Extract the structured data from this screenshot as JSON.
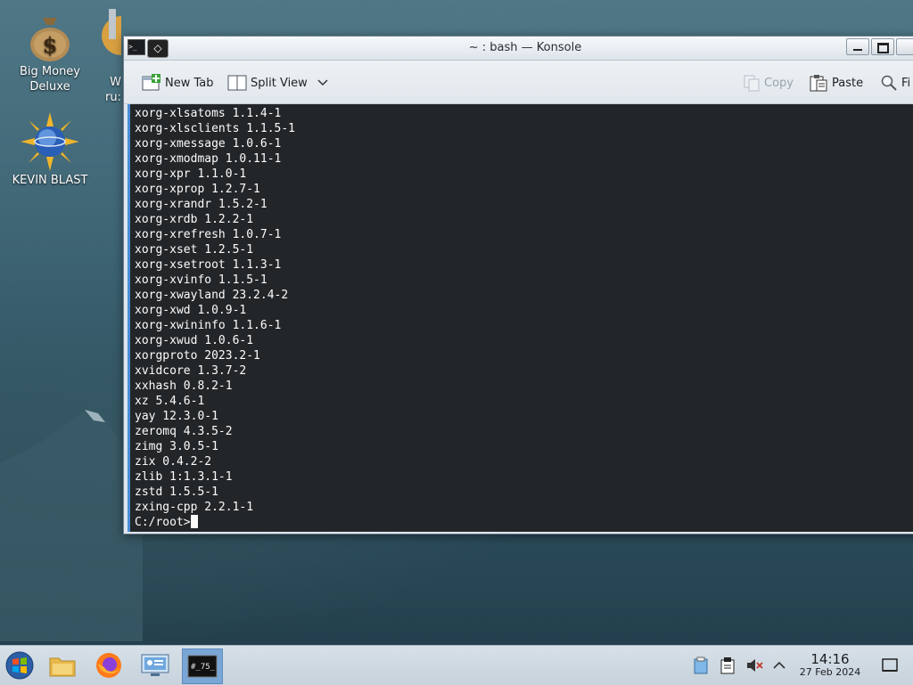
{
  "desktop": {
    "icons": [
      {
        "label_line1": "Big Money",
        "label_line2": "Deluxe",
        "icon": "money-bag-icon"
      },
      {
        "label_line1": "KEVIN BLAST",
        "icon": "globe-sun-icon"
      },
      {
        "label_line1": "W",
        "label_line2": "ru:",
        "icon": "gear-app-icon"
      }
    ]
  },
  "window": {
    "title": "~ : bash — Konsole",
    "toolbar": {
      "new_tab": "New Tab",
      "split_view": "Split View",
      "copy": "Copy",
      "paste": "Paste",
      "find": "Fi"
    }
  },
  "terminal": {
    "lines": [
      "xorg-xlsatoms 1.1.4-1",
      "xorg-xlsclients 1.1.5-1",
      "xorg-xmessage 1.0.6-1",
      "xorg-xmodmap 1.0.11-1",
      "xorg-xpr 1.1.0-1",
      "xorg-xprop 1.2.7-1",
      "xorg-xrandr 1.5.2-1",
      "xorg-xrdb 1.2.2-1",
      "xorg-xrefresh 1.0.7-1",
      "xorg-xset 1.2.5-1",
      "xorg-xsetroot 1.1.3-1",
      "xorg-xvinfo 1.1.5-1",
      "xorg-xwayland 23.2.4-2",
      "xorg-xwd 1.0.9-1",
      "xorg-xwininfo 1.1.6-1",
      "xorg-xwud 1.0.6-1",
      "xorgproto 2023.2-1",
      "xvidcore 1.3.7-2",
      "xxhash 0.8.2-1",
      "xz 5.4.6-1",
      "yay 12.3.0-1",
      "zeromq 4.3.5-2",
      "zimg 3.0.5-1",
      "zix 0.4.2-2",
      "zlib 1:1.3.1-1",
      "zstd 1.5.5-1",
      "zxing-cpp 2.2.1-1"
    ],
    "prompt": "C:/root>"
  },
  "taskbar": {
    "items": [
      "start-menu-icon",
      "file-manager-icon",
      "firefox-icon",
      "system-settings-icon",
      "konsole-icon"
    ],
    "konsole_label": "#_75_",
    "clock_time": "14:16",
    "clock_date": "27 Feb 2024"
  },
  "colors": {
    "terminal_bg": "#232629",
    "terminal_fg": "#fcfcfc",
    "accent": "#4a8dd8"
  }
}
